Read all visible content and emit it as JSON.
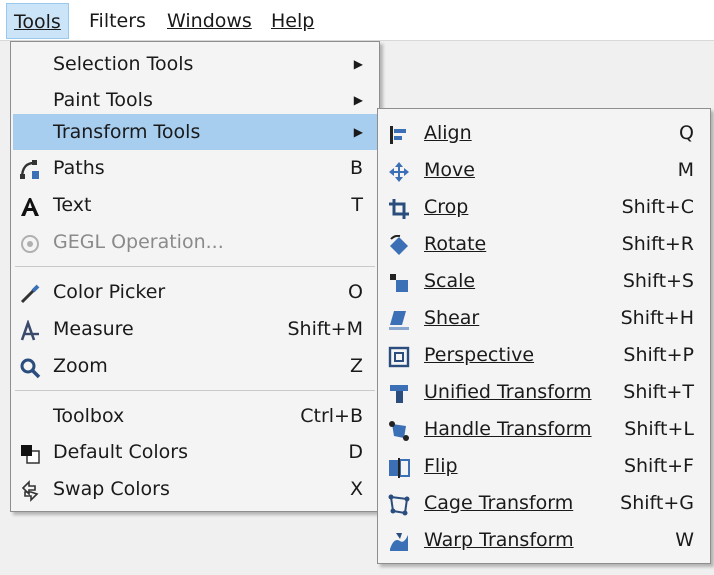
{
  "menubar": {
    "items": [
      {
        "label": "Tools",
        "active": true
      },
      {
        "label": "Filters",
        "active": false
      },
      {
        "label": "Windows",
        "active": false
      },
      {
        "label": "Help",
        "active": false
      }
    ]
  },
  "tools_menu": {
    "items": [
      {
        "label": "Selection Tools",
        "shortcut": "",
        "submenu": true,
        "icon": "none"
      },
      {
        "label": "Paint Tools",
        "shortcut": "",
        "submenu": true,
        "icon": "none"
      },
      {
        "label": "Transform Tools",
        "shortcut": "",
        "submenu": true,
        "icon": "none",
        "highlighted": true
      },
      {
        "label": "Paths",
        "shortcut": "B",
        "icon": "paths-icon"
      },
      {
        "label": "Text",
        "shortcut": "T",
        "icon": "text-icon"
      },
      {
        "label": "GEGL Operation...",
        "shortcut": "",
        "icon": "gegl-icon",
        "disabled": true
      },
      {
        "label": "Color Picker",
        "shortcut": "O",
        "icon": "color-picker-icon"
      },
      {
        "label": "Measure",
        "shortcut": "Shift+M",
        "icon": "measure-icon"
      },
      {
        "label": "Zoom",
        "shortcut": "Z",
        "icon": "zoom-icon"
      },
      {
        "label": "Toolbox",
        "shortcut": "Ctrl+B",
        "icon": "none"
      },
      {
        "label": "Default Colors",
        "shortcut": "D",
        "icon": "default-colors-icon"
      },
      {
        "label": "Swap Colors",
        "shortcut": "X",
        "icon": "swap-colors-icon"
      }
    ]
  },
  "transform_menu": {
    "items": [
      {
        "label": "Align",
        "shortcut": "Q",
        "icon": "align-icon"
      },
      {
        "label": "Move",
        "shortcut": "M",
        "icon": "move-icon"
      },
      {
        "label": "Crop",
        "shortcut": "Shift+C",
        "icon": "crop-icon"
      },
      {
        "label": "Rotate",
        "shortcut": "Shift+R",
        "icon": "rotate-icon"
      },
      {
        "label": "Scale",
        "shortcut": "Shift+S",
        "icon": "scale-icon"
      },
      {
        "label": "Shear",
        "shortcut": "Shift+H",
        "icon": "shear-icon"
      },
      {
        "label": "Perspective",
        "shortcut": "Shift+P",
        "icon": "perspective-icon"
      },
      {
        "label": "Unified Transform",
        "shortcut": "Shift+T",
        "icon": "unified-transform-icon"
      },
      {
        "label": "Handle Transform",
        "shortcut": "Shift+L",
        "icon": "handle-transform-icon"
      },
      {
        "label": "Flip",
        "shortcut": "Shift+F",
        "icon": "flip-icon"
      },
      {
        "label": "Cage Transform",
        "shortcut": "Shift+G",
        "icon": "cage-transform-icon"
      },
      {
        "label": "Warp Transform",
        "shortcut": "W",
        "icon": "warp-transform-icon"
      }
    ]
  },
  "colors": {
    "highlight": "#a7cdef",
    "menubar_active": "#cce4f7",
    "icon_blue": "#3b6fb6",
    "disabled_text": "#8a8a8a"
  }
}
